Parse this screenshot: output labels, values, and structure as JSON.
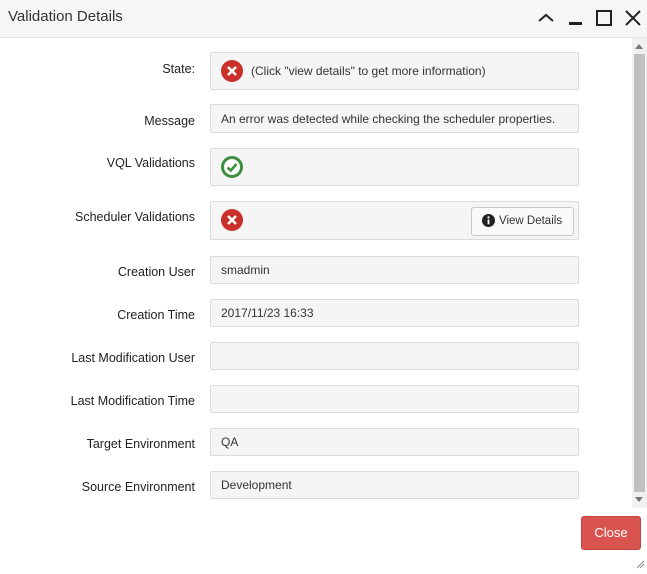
{
  "window": {
    "title": "Validation Details",
    "controls": [
      "collapse",
      "minimize",
      "maximize",
      "close"
    ]
  },
  "fields": {
    "state": {
      "label": "State:",
      "status": "error",
      "text": "(Click \"view details\" to get more information)"
    },
    "message": {
      "label": "Message",
      "value": "An error was detected while checking the scheduler properties."
    },
    "vql_validations": {
      "label": "VQL Validations",
      "status": "ok"
    },
    "scheduler_validations": {
      "label": "Scheduler Validations",
      "status": "error",
      "button_label": "View Details"
    },
    "creation_user": {
      "label": "Creation User",
      "value": "smadmin"
    },
    "creation_time": {
      "label": "Creation Time",
      "value": "2017/11/23 16:33"
    },
    "last_modification_user": {
      "label": "Last Modification User",
      "value": ""
    },
    "last_modification_time": {
      "label": "Last Modification Time",
      "value": ""
    },
    "target_environment": {
      "label": "Target Environment",
      "value": "QA"
    },
    "source_environment": {
      "label": "Source Environment",
      "value": "Development"
    }
  },
  "footer": {
    "close_label": "Close"
  },
  "colors": {
    "error": "#c9302c",
    "success": "#3c8f3c",
    "close_button": "#d9534f"
  }
}
